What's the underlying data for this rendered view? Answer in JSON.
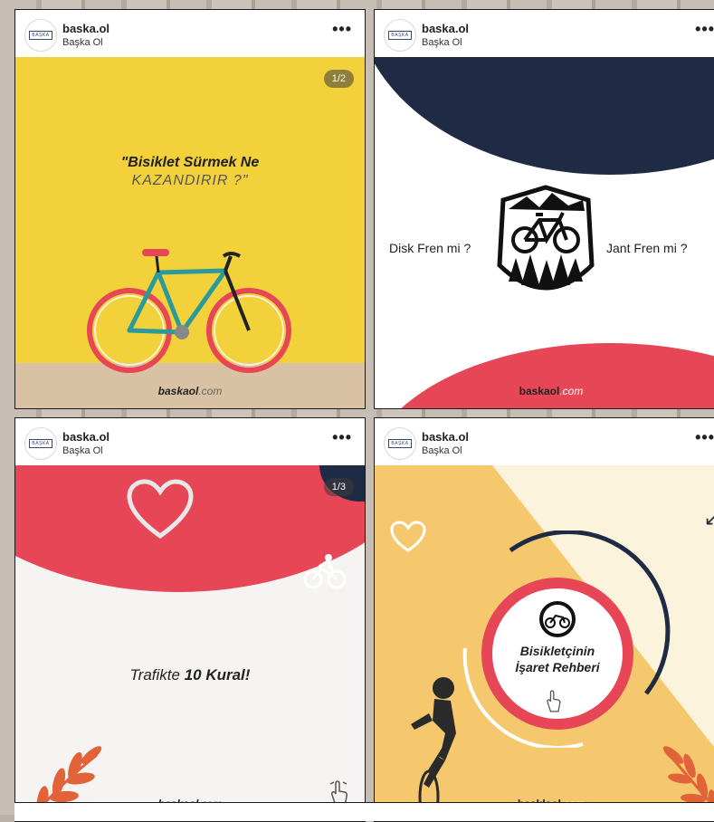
{
  "posts": [
    {
      "username": "baska.ol",
      "subtitle": "Başka Ol",
      "avatar_text": "BAŞKA",
      "more": "•••",
      "counter": "1/2",
      "title_line1": "\"Bisiklet Sürmek Ne",
      "title_line2": "KAZANDIRIR ?\"",
      "brand_bold": "baskaol",
      "brand_light": ".com"
    },
    {
      "username": "baska.ol",
      "subtitle": "Başka Ol",
      "avatar_text": "BAŞKA",
      "more": "•••",
      "left_text": "Disk Fren mi ?",
      "right_text": "Jant Fren mi ?",
      "brand_bold": "baskaol",
      "brand_light": ".com"
    },
    {
      "username": "baska.ol",
      "subtitle": "Başka Ol",
      "avatar_text": "BAŞKA",
      "more": "•••",
      "counter": "1/3",
      "headline_light": "Trafikte ",
      "headline_bold": "10 Kural!",
      "brand_bold": "baskaol",
      "brand_light": ".com"
    },
    {
      "username": "baska.ol",
      "subtitle": "Başka Ol",
      "avatar_text": "BAŞKA",
      "more": "•••",
      "circle_line1": "Bisikletçinin",
      "circle_line2": "İşaret Rehberi",
      "brand_bold": "basklaol",
      "brand_light": ".com"
    }
  ],
  "colors": {
    "yellow": "#f3d13b",
    "navy": "#1f2a44",
    "red": "#e64656",
    "cream": "#fbf3dc",
    "orange": "#f6c86e",
    "leaf": "#e2623a"
  }
}
